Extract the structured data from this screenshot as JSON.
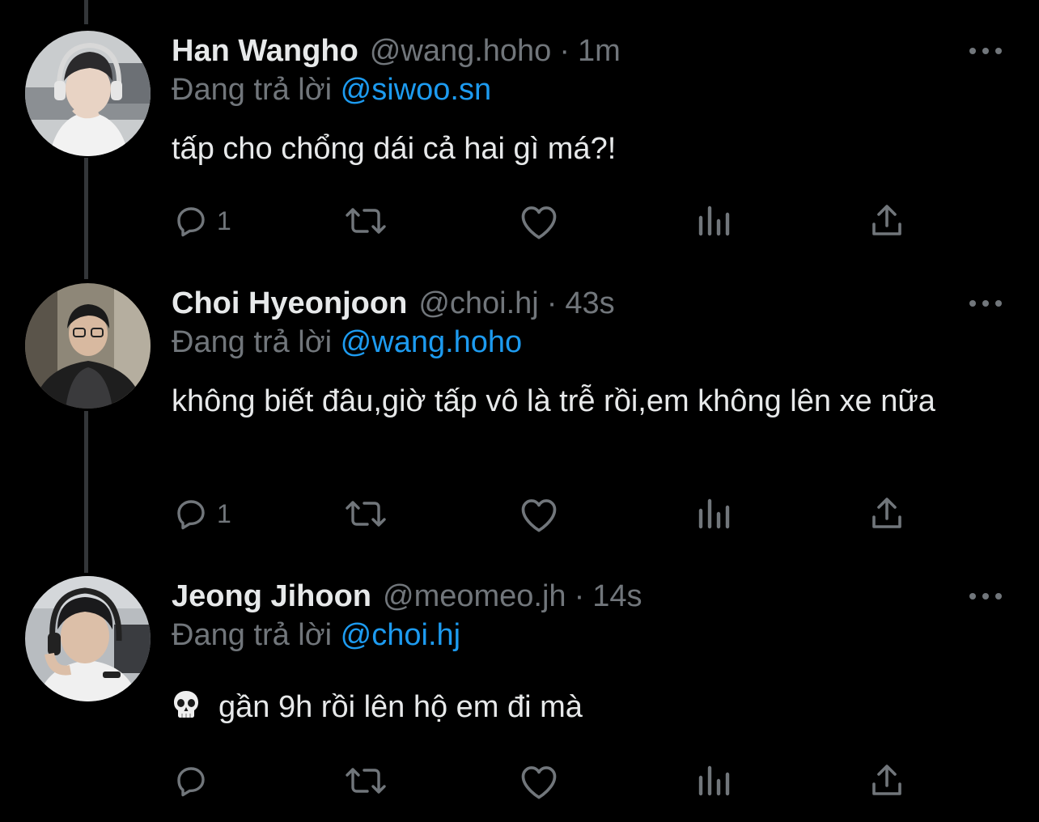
{
  "tweets": [
    {
      "name": "Han Wangho",
      "handle": "@wang.hoho",
      "time": "1m",
      "reply_prefix": "Đang trả lời",
      "reply_to": "@siwoo.sn",
      "text": "tấp cho chổng dái cả hai gì má?!",
      "reply_count": "1"
    },
    {
      "name": "Choi Hyeonjoon",
      "handle": "@choi.hj",
      "time": "43s",
      "reply_prefix": "Đang trả lời",
      "reply_to": "@wang.hoho",
      "text": "không biết đâu,giờ tấp vô là trễ rồi,em không lên xe nữa",
      "reply_count": "1"
    },
    {
      "name": "Jeong Jihoon",
      "handle": "@meomeo.jh",
      "time": "14s",
      "reply_prefix": "Đang trả lời",
      "reply_to": "@choi.hj",
      "text": "gần 9h rồi lên hộ em đi mà",
      "emoji": "skull-icon",
      "reply_count": ""
    }
  ],
  "separator": "·",
  "colors": {
    "background": "#000000",
    "text": "#e7e9ea",
    "muted": "#71767b",
    "accent": "#1d9bf0",
    "thread_line": "#333639"
  }
}
